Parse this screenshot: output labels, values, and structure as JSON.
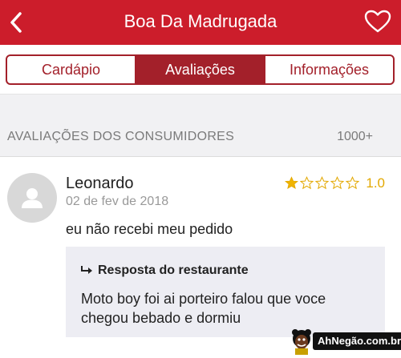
{
  "header": {
    "title": "Boa Da Madrugada",
    "back_icon": "chevron-left-icon",
    "favorite_icon": "heart-icon",
    "bg_color": "#cc1d2b"
  },
  "tabs": [
    {
      "label": "Cardápio",
      "active": false
    },
    {
      "label": "Avaliações",
      "active": true
    },
    {
      "label": "Informações",
      "active": false
    }
  ],
  "reviews_section": {
    "title": "AVALIAÇÕES DOS CONSUMIDORES",
    "count": "1000+"
  },
  "review": {
    "author": "Leonardo",
    "date": "02 de fev de 2018",
    "stars_filled": 1,
    "stars_total": 5,
    "rating": "1.0",
    "comment": "eu não recebi meu pedido",
    "reply": {
      "title": "Resposta do restaurante",
      "text": "Moto boy foi ai porteiro falou que voce chegou bebado  e dormiu"
    }
  },
  "watermark": {
    "text": "AhNegão.com.br"
  }
}
